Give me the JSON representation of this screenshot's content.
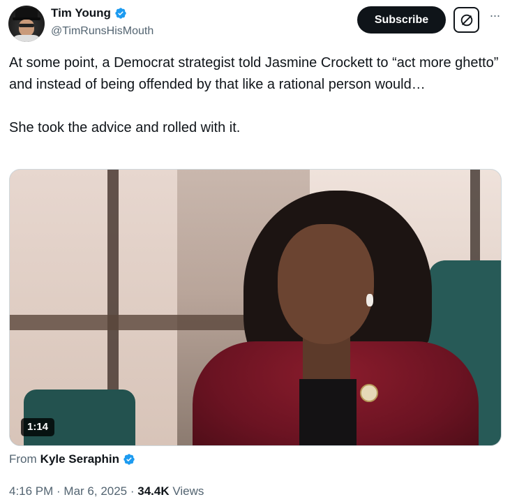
{
  "author": {
    "display_name": "Tim Young",
    "handle": "@TimRunsHisMouth",
    "verified_icon": "verified-badge-icon",
    "accent_color": "#1d9bf0"
  },
  "actions": {
    "subscribe_label": "Subscribe",
    "grok_icon": "grok-icon",
    "more_label": "···"
  },
  "tweet": {
    "line1": "At some point, a Democrat strategist told Jasmine Crockett to “act more ghetto” and instead of being offended by that like a rational person would…",
    "line2": "She took the advice and rolled with it."
  },
  "media": {
    "duration": "1:14"
  },
  "attribution": {
    "prefix": "From",
    "name": "Kyle Seraphin"
  },
  "meta": {
    "time": "4:16 PM",
    "separator1": " · ",
    "date": "Mar 6, 2025",
    "separator2": " · ",
    "views_count": "34.4K",
    "views_label": " Views"
  }
}
